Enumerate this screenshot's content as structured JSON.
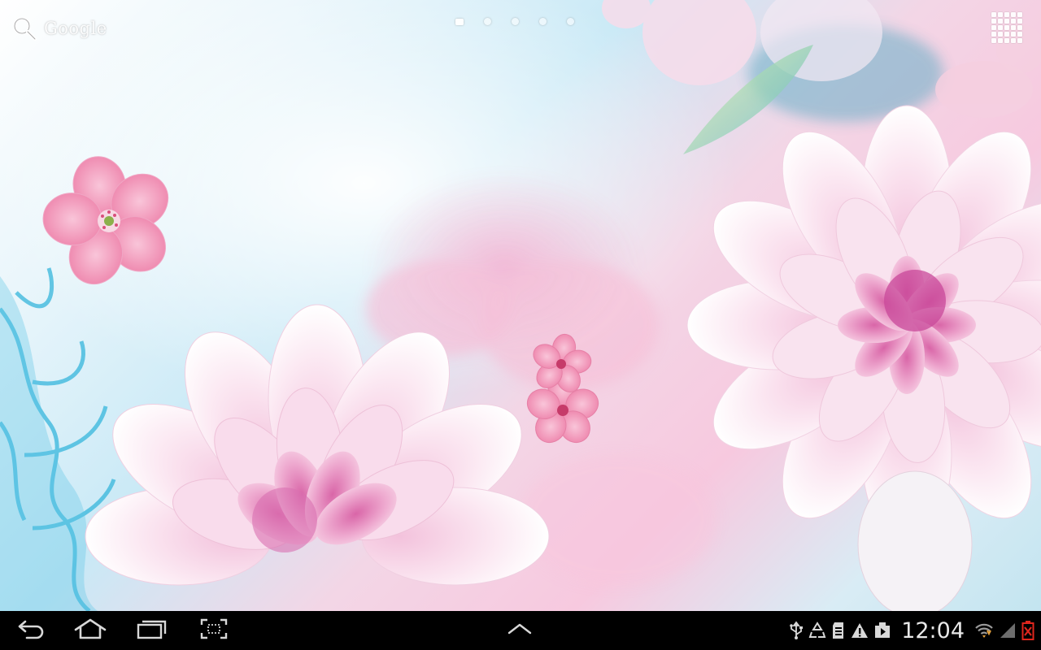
{
  "screen": {
    "type": "android-tablet-home"
  },
  "top_bar": {
    "search_label": "Google",
    "page_indicator": {
      "total": 5,
      "active_index": 0
    }
  },
  "system_bar": {
    "clock": "12:04",
    "nav_buttons": [
      "back-icon",
      "home-icon",
      "recent-apps-icon",
      "screenshot-icon"
    ],
    "center_button": "chevron-up-icon",
    "status_icons": [
      "usb-icon",
      "recycle-icon",
      "sd-card-icon",
      "warning-icon",
      "download-icon",
      "wifi-icon",
      "signal-icon",
      "battery-icon"
    ]
  },
  "colors": {
    "system_bar_bg": "#000000",
    "icon_color": "#d8d8d8",
    "battery_alert": "#e0261d",
    "wifi_alert": "#e8a33c"
  }
}
